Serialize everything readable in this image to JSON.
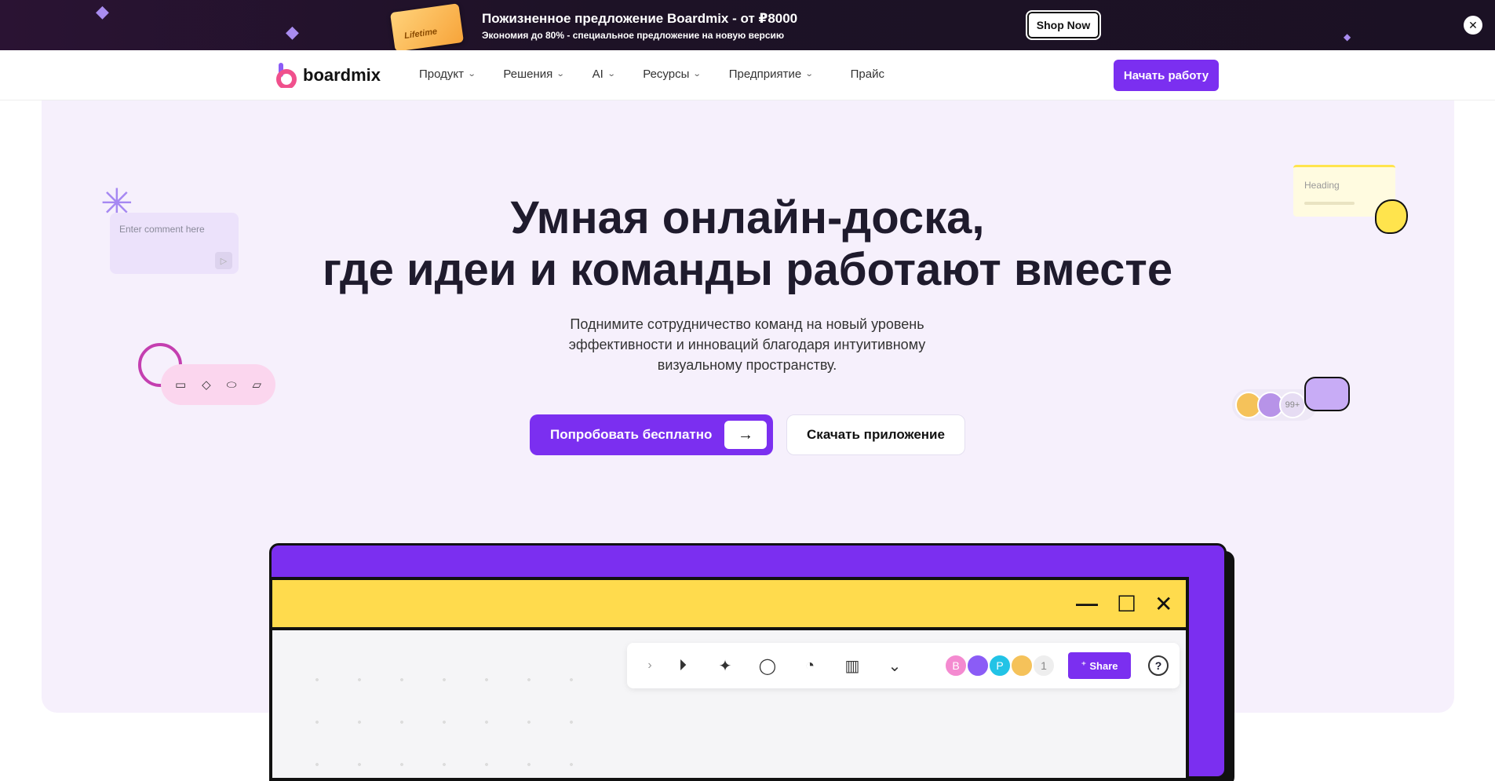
{
  "promo": {
    "coupon_label": "Lifetime",
    "title": "Пожизненное предложение Boardmix - от ₽8000",
    "subtitle": "Экономия до 80% - специальное предложение на новую версию",
    "shop_label": "Shop Now",
    "close_glyph": "✕"
  },
  "nav": {
    "brand": "boardmix",
    "menu": [
      {
        "label": "Продукт"
      },
      {
        "label": "Решения"
      },
      {
        "label": "AI"
      },
      {
        "label": "Ресурсы"
      },
      {
        "label": "Предприятие"
      },
      {
        "label": "Прайс"
      }
    ],
    "cta": "Начать работу"
  },
  "hero": {
    "heading_line1": "Умная онлайн-доска,",
    "heading_line2": "где идеи и команды работают вместе",
    "lead": "Поднимите сотрудничество команд на новый уровень эффективности и инноваций благодаря интуитивному визуальному пространству.",
    "primary_cta": "Попробовать бесплатно",
    "secondary_cta": "Скачать приложение"
  },
  "decor": {
    "comment_placeholder": "Enter comment here",
    "note_heading": "Heading",
    "avatars_count": "99+"
  },
  "app_window": {
    "collaborator_letters": [
      "B",
      "",
      "P",
      ""
    ],
    "collaborator_count": "1",
    "share_label": "Share",
    "help_glyph": "?"
  },
  "colors": {
    "accent": "#7b2ff0",
    "hero_bg": "#f6f0fc",
    "window_title_bg": "#ffdb4d"
  }
}
